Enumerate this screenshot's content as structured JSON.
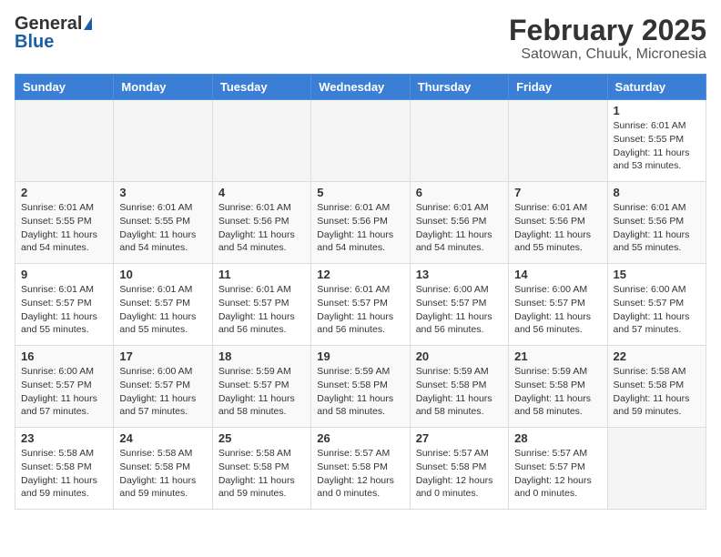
{
  "header": {
    "logo_general": "General",
    "logo_blue": "Blue",
    "title": "February 2025",
    "subtitle": "Satowan, Chuuk, Micronesia"
  },
  "weekdays": [
    "Sunday",
    "Monday",
    "Tuesday",
    "Wednesday",
    "Thursday",
    "Friday",
    "Saturday"
  ],
  "weeks": [
    [
      {
        "day": "",
        "info": ""
      },
      {
        "day": "",
        "info": ""
      },
      {
        "day": "",
        "info": ""
      },
      {
        "day": "",
        "info": ""
      },
      {
        "day": "",
        "info": ""
      },
      {
        "day": "",
        "info": ""
      },
      {
        "day": "1",
        "info": "Sunrise: 6:01 AM\nSunset: 5:55 PM\nDaylight: 11 hours\nand 53 minutes."
      }
    ],
    [
      {
        "day": "2",
        "info": "Sunrise: 6:01 AM\nSunset: 5:55 PM\nDaylight: 11 hours\nand 54 minutes."
      },
      {
        "day": "3",
        "info": "Sunrise: 6:01 AM\nSunset: 5:55 PM\nDaylight: 11 hours\nand 54 minutes."
      },
      {
        "day": "4",
        "info": "Sunrise: 6:01 AM\nSunset: 5:56 PM\nDaylight: 11 hours\nand 54 minutes."
      },
      {
        "day": "5",
        "info": "Sunrise: 6:01 AM\nSunset: 5:56 PM\nDaylight: 11 hours\nand 54 minutes."
      },
      {
        "day": "6",
        "info": "Sunrise: 6:01 AM\nSunset: 5:56 PM\nDaylight: 11 hours\nand 54 minutes."
      },
      {
        "day": "7",
        "info": "Sunrise: 6:01 AM\nSunset: 5:56 PM\nDaylight: 11 hours\nand 55 minutes."
      },
      {
        "day": "8",
        "info": "Sunrise: 6:01 AM\nSunset: 5:56 PM\nDaylight: 11 hours\nand 55 minutes."
      }
    ],
    [
      {
        "day": "9",
        "info": "Sunrise: 6:01 AM\nSunset: 5:57 PM\nDaylight: 11 hours\nand 55 minutes."
      },
      {
        "day": "10",
        "info": "Sunrise: 6:01 AM\nSunset: 5:57 PM\nDaylight: 11 hours\nand 55 minutes."
      },
      {
        "day": "11",
        "info": "Sunrise: 6:01 AM\nSunset: 5:57 PM\nDaylight: 11 hours\nand 56 minutes."
      },
      {
        "day": "12",
        "info": "Sunrise: 6:01 AM\nSunset: 5:57 PM\nDaylight: 11 hours\nand 56 minutes."
      },
      {
        "day": "13",
        "info": "Sunrise: 6:00 AM\nSunset: 5:57 PM\nDaylight: 11 hours\nand 56 minutes."
      },
      {
        "day": "14",
        "info": "Sunrise: 6:00 AM\nSunset: 5:57 PM\nDaylight: 11 hours\nand 56 minutes."
      },
      {
        "day": "15",
        "info": "Sunrise: 6:00 AM\nSunset: 5:57 PM\nDaylight: 11 hours\nand 57 minutes."
      }
    ],
    [
      {
        "day": "16",
        "info": "Sunrise: 6:00 AM\nSunset: 5:57 PM\nDaylight: 11 hours\nand 57 minutes."
      },
      {
        "day": "17",
        "info": "Sunrise: 6:00 AM\nSunset: 5:57 PM\nDaylight: 11 hours\nand 57 minutes."
      },
      {
        "day": "18",
        "info": "Sunrise: 5:59 AM\nSunset: 5:57 PM\nDaylight: 11 hours\nand 58 minutes."
      },
      {
        "day": "19",
        "info": "Sunrise: 5:59 AM\nSunset: 5:58 PM\nDaylight: 11 hours\nand 58 minutes."
      },
      {
        "day": "20",
        "info": "Sunrise: 5:59 AM\nSunset: 5:58 PM\nDaylight: 11 hours\nand 58 minutes."
      },
      {
        "day": "21",
        "info": "Sunrise: 5:59 AM\nSunset: 5:58 PM\nDaylight: 11 hours\nand 58 minutes."
      },
      {
        "day": "22",
        "info": "Sunrise: 5:58 AM\nSunset: 5:58 PM\nDaylight: 11 hours\nand 59 minutes."
      }
    ],
    [
      {
        "day": "23",
        "info": "Sunrise: 5:58 AM\nSunset: 5:58 PM\nDaylight: 11 hours\nand 59 minutes."
      },
      {
        "day": "24",
        "info": "Sunrise: 5:58 AM\nSunset: 5:58 PM\nDaylight: 11 hours\nand 59 minutes."
      },
      {
        "day": "25",
        "info": "Sunrise: 5:58 AM\nSunset: 5:58 PM\nDaylight: 11 hours\nand 59 minutes."
      },
      {
        "day": "26",
        "info": "Sunrise: 5:57 AM\nSunset: 5:58 PM\nDaylight: 12 hours\nand 0 minutes."
      },
      {
        "day": "27",
        "info": "Sunrise: 5:57 AM\nSunset: 5:58 PM\nDaylight: 12 hours\nand 0 minutes."
      },
      {
        "day": "28",
        "info": "Sunrise: 5:57 AM\nSunset: 5:57 PM\nDaylight: 12 hours\nand 0 minutes."
      },
      {
        "day": "",
        "info": ""
      }
    ]
  ]
}
